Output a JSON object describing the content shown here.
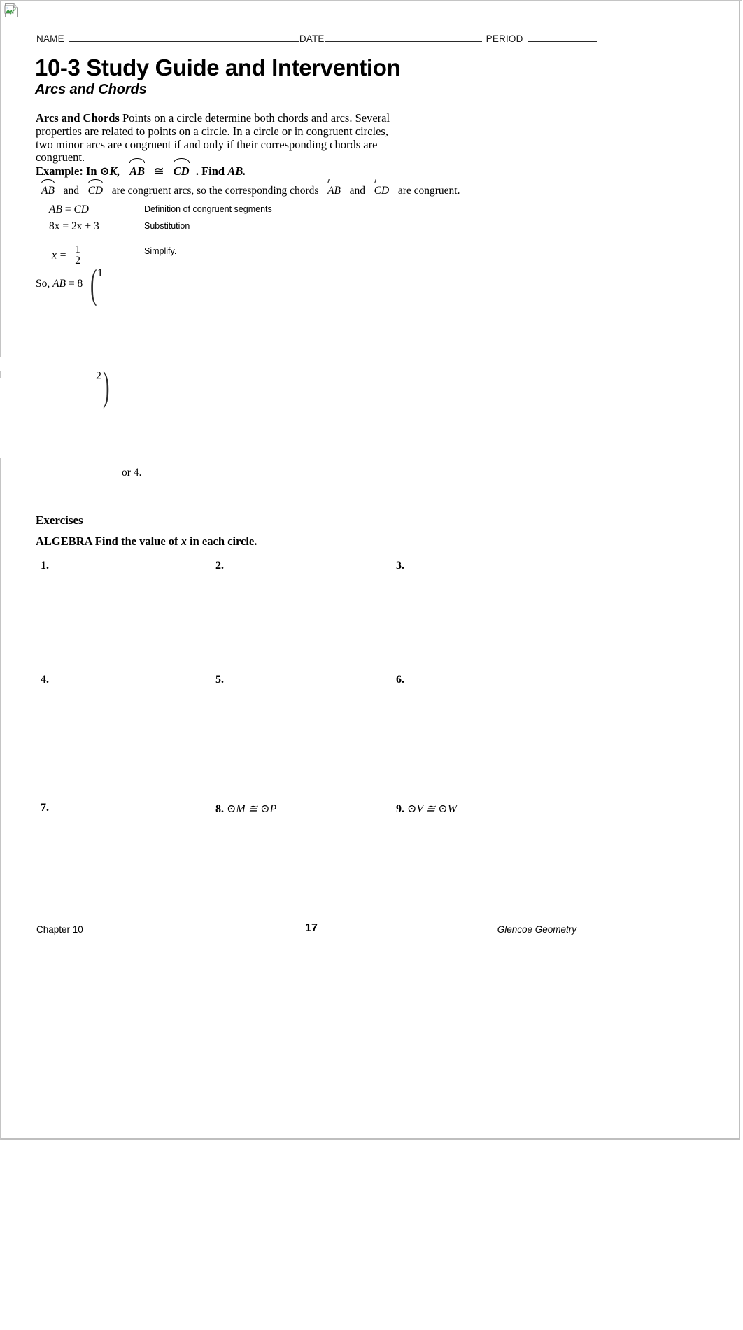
{
  "header": {
    "name_label": "NAME",
    "date_label": "DATE",
    "period_label": "PERIOD"
  },
  "title": {
    "main": "10-3 Study Guide and Intervention",
    "subtitle": "Arcs and Chords"
  },
  "concept": {
    "heading": "Arcs and Chords",
    "body": " Points on a circle determine both chords and arcs. Several properties are related to points on a circle. In a circle or in congruent circles, two minor arcs are congruent if and only if their corresponding chords are congruent."
  },
  "example": {
    "label": "Example:",
    "prefix": "In ",
    "circle_k": "⊙K,",
    "arc1": "AB",
    "cong": "≅",
    "arc2": "CD",
    "suffix": ". Find ",
    "find": "AB.",
    "line2_arc1": "AB",
    "line2_and": "and",
    "line2_arc2": "CD",
    "line2_mid": "are congruent arcs, so the corresponding chords",
    "line2_chord1": "AB",
    "line2_and2": "and",
    "line2_chord2": "CD",
    "line2_end": "are congruent.",
    "steps": [
      {
        "equation_left": "AB",
        "equation_rest": " = ",
        "equation_right": "CD",
        "reason": "Definition of congruent segments"
      },
      {
        "equation": "8x = 2x + 3",
        "reason": "Substitution"
      },
      {
        "equation": "x =",
        "fraction_num": "1",
        "fraction_den": "2",
        "reason": "Simplify."
      }
    ],
    "conclusion_prefix": "So, ",
    "conclusion_var": "AB",
    "conclusion_rest": " = 8",
    "paren_num_1": "1",
    "paren_num_2": "2",
    "paren_open": "(",
    "paren_close": ")",
    "or_four": "or 4."
  },
  "exercises": {
    "heading": "Exercises",
    "instruction_prefix": "ALGEBRA Find the value of ",
    "instruction_var": "x",
    "instruction_suffix": " in each circle.",
    "items": [
      {
        "number": "1.",
        "extra": ""
      },
      {
        "number": "2.",
        "extra": ""
      },
      {
        "number": "3.",
        "extra": ""
      },
      {
        "number": "4.",
        "extra": ""
      },
      {
        "number": "5.",
        "extra": ""
      },
      {
        "number": "6.",
        "extra": ""
      },
      {
        "number": "7.",
        "extra": ""
      },
      {
        "number": "8.",
        "extra": " ⊙M ≅ ⊙P"
      },
      {
        "number": "9.",
        "extra": " ⊙V ≅ ⊙W"
      }
    ]
  },
  "footer": {
    "left": "Chapter 10",
    "page_number": "17",
    "right": "Glencoe Geometry"
  },
  "icons": {
    "broken_image": "broken-image-icon"
  }
}
